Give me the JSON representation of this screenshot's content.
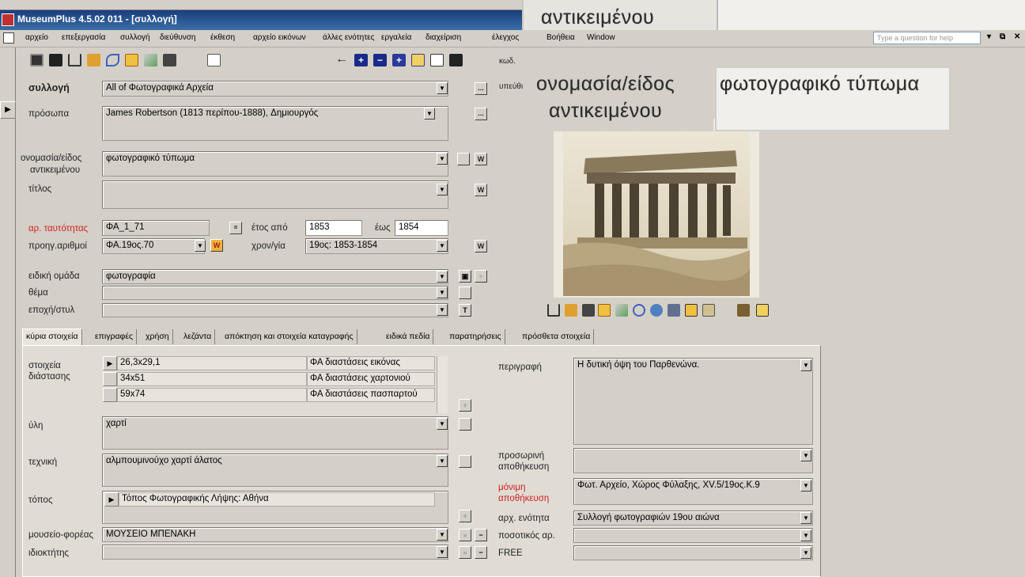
{
  "window": {
    "title": "MuseumPlus 4.5.02 011 - [συλλογή]"
  },
  "menu": [
    "αρχείο",
    "επεξεργασία",
    "συλλογή",
    "διεύθυνση",
    "έκθεση",
    "αρχείο εικόνων",
    "άλλες ενότητες",
    "εργαλεία",
    "διαχείριση",
    "έλεγχος",
    "Βοήθεια",
    "Window"
  ],
  "help_placeholder": "Type a question for help",
  "window_buttons": [
    "▾",
    "⧉",
    "✕"
  ],
  "toolbar_icons": [
    "form-icon",
    "binoculars-icon",
    "columns-icon",
    "person-icon",
    "arrow-icon",
    "folder-icon",
    "pen-icon",
    "camera-icon",
    "envelope-icon",
    "back-arrow-icon",
    "plus-icon",
    "minus-icon",
    "plus-blue-icon",
    "user-icon",
    "preview-icon",
    "find-icon"
  ],
  "form": {
    "kod_label": "κωδ.",
    "ypeuth_label": "υπεύθι",
    "collection": {
      "label": "συλλογή",
      "value": "All of Φωτογραφικά Αρχεία"
    },
    "persons": {
      "label": "πρόσωπα",
      "value": "James Robertson (1813 περίπου-1888), Δημιουργός"
    },
    "object_name": {
      "label_1": "ονομασία/είδος",
      "label_2": "αντικειμένου",
      "value": "φωτογραφικό τύπωμα"
    },
    "title": {
      "label": "τίτλος",
      "value": ""
    },
    "identity_no": {
      "label": "αρ. ταυτότητας",
      "value": "ΦΑ_1_71"
    },
    "year_from": {
      "label": "έτος από",
      "value": "1853"
    },
    "year_to": {
      "label": "έως",
      "value": "1854"
    },
    "prev_no": {
      "label": "προηγ.αριθμοί",
      "value": "ΦΑ.19ος.70"
    },
    "chronology": {
      "label": "χρον/γία",
      "value": "19ος: 1853-1854"
    },
    "special_group": {
      "label": "ειδική ομάδα",
      "value": "φωτογραφία"
    },
    "subject": {
      "label": "θέμα",
      "value": ""
    },
    "era_style": {
      "label": "εποχή/στυλ",
      "value": ""
    },
    "w_label": "W",
    "t_label": "T"
  },
  "zoom": {
    "label_1": "ονομασία/είδος",
    "label_2": "αντικειμένου",
    "value": "φωτογραφικό τύπωμα",
    "top_label": "αντικειμένου"
  },
  "tabs": [
    "κύρια στοιχεία",
    "επιγραφές",
    "χρήση",
    "λεζάντα",
    "απόκτηση και στοιχεία καταγραφής",
    "ειδικά πεδία",
    "παρατηρήσεις",
    "πρόσθετα στοιχεία"
  ],
  "main": {
    "dimensions": {
      "label_1": "στοιχεία",
      "label_2": "διάστασης",
      "rows": [
        {
          "value": "26,3x29,1",
          "type": "ΦΑ διαστάσεις εικόνας"
        },
        {
          "value": "34x51",
          "type": "ΦΑ διαστάσεις χαρτονιού"
        },
        {
          "value": "59x74",
          "type": "ΦΑ διαστάσεις πασπαρτού"
        }
      ]
    },
    "material": {
      "label": "ύλη",
      "value": "χαρτί"
    },
    "technique": {
      "label": "τεχνική",
      "value": "αλμπουμινούχο χαρτί άλατος"
    },
    "place": {
      "label": "τόπος",
      "value": "Τόπος Φωτογραφικής Λήψης: Αθήνα"
    },
    "museum": {
      "label": "μουσείο-φορέας",
      "value": "ΜΟΥΣΕΙΟ ΜΠΕΝΑΚΗ"
    },
    "owner": {
      "label": "ιδιοκτήτης",
      "value": ""
    },
    "description": {
      "label": "περιγραφή",
      "value": "Η δυτική όψη του Παρθενώνα."
    },
    "temp_storage": {
      "label_1": "προσωρινή",
      "label_2": "αποθήκευση",
      "value": ""
    },
    "perm_storage": {
      "label_1": "μόνιμη",
      "label_2": "αποθήκευση",
      "value": "Φωτ. Αρχείο, Χώρος Φύλαξης, XV.5/19ος.Κ.9"
    },
    "archive_unit": {
      "label": "αρχ. ενότητα",
      "value": "Συλλογή φωτογραφιών 19ου αιώνα"
    },
    "quantity": {
      "label": "ποσοτικός αρ.",
      "value": ""
    },
    "free": {
      "label": "FREE",
      "value": ""
    }
  }
}
